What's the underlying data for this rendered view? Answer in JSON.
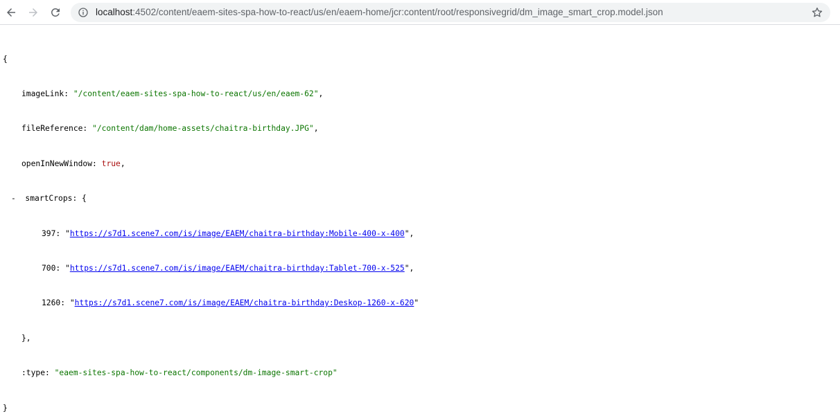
{
  "browser": {
    "url_host": "localhost",
    "url_rest": ":4502/content/eaem-sites-spa-how-to-react/us/en/eaem-home/jcr:content/root/responsivegrid/dm_image_smart_crop.model.json"
  },
  "json": {
    "open_brace": "{",
    "close_brace": "}",
    "imageLink_key": "imageLink",
    "imageLink_value": "\"/content/eaem-sites-spa-how-to-react/us/en/eaem-62\"",
    "fileReference_key": "fileReference",
    "fileReference_value": "\"/content/dam/home-assets/chaitra-birthday.JPG\"",
    "openInNewWindow_key": "openInNewWindow",
    "openInNewWindow_value": "true",
    "smartCrops_toggle": "-",
    "smartCrops_key": "smartCrops",
    "crops": [
      {
        "key": "397",
        "url": "https://s7d1.scene7.com/is/image/EAEM/chaitra-birthday:Mobile-400-x-400"
      },
      {
        "key": "700",
        "url": "https://s7d1.scene7.com/is/image/EAEM/chaitra-birthday:Tablet-700-x-525"
      },
      {
        "key": "1260",
        "url": "https://s7d1.scene7.com/is/image/EAEM/chaitra-birthday:Deskop-1260-x-620"
      }
    ],
    "type_key": ":type",
    "type_value": "\"eaem-sites-spa-how-to-react/components/dm-image-smart-crop\""
  },
  "colors": {
    "string": "#0b7500",
    "boolean": "#a11111",
    "link": "#0000ee"
  },
  "icons": [
    "back-arrow-icon",
    "forward-arrow-icon",
    "reload-icon",
    "info-icon",
    "star-icon"
  ]
}
